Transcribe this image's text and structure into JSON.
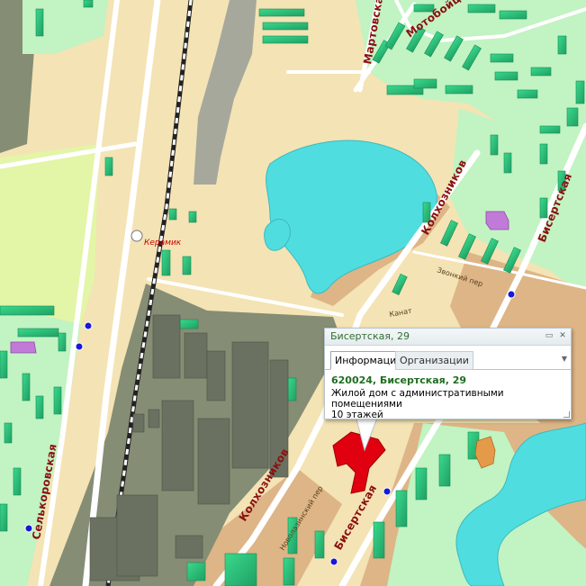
{
  "map": {
    "streets": {
      "martovskaya": "Мартовская",
      "motobojcev": "Мотобойцев пер",
      "kolhoznikov_top": "Колхозников",
      "kolhoznikov_bottom": "Колхозников",
      "bisertskaya_top": "Бисертская",
      "bisertskaya_bottom": "Бисертская",
      "selkorovskaya": "Селькоровская",
      "zvonkij": "Звонкий пер",
      "kanat": "Канат",
      "novolazhinsky": "Новолазинский пер"
    },
    "station_label": "Керамик",
    "colors": {
      "ground": "#f4e3b4",
      "lake": "#4fdde0",
      "park": "#c2f3c2",
      "industrial": "#858d74",
      "building": "#2fc27b",
      "building_highlight": "#e00010",
      "bus_stop": "#1818d8",
      "street_label": "#8a1111"
    }
  },
  "popup": {
    "title": "Бисертская, 29",
    "controls": [
      "▭",
      "✕"
    ],
    "tabs": [
      {
        "label": "Информация",
        "active": true
      },
      {
        "label": "Организации",
        "active": false
      }
    ],
    "address": "620024, Бисертская, 29",
    "description_line1": "Жилой дом с административными помещениями",
    "description_line2": "10 этажей"
  }
}
